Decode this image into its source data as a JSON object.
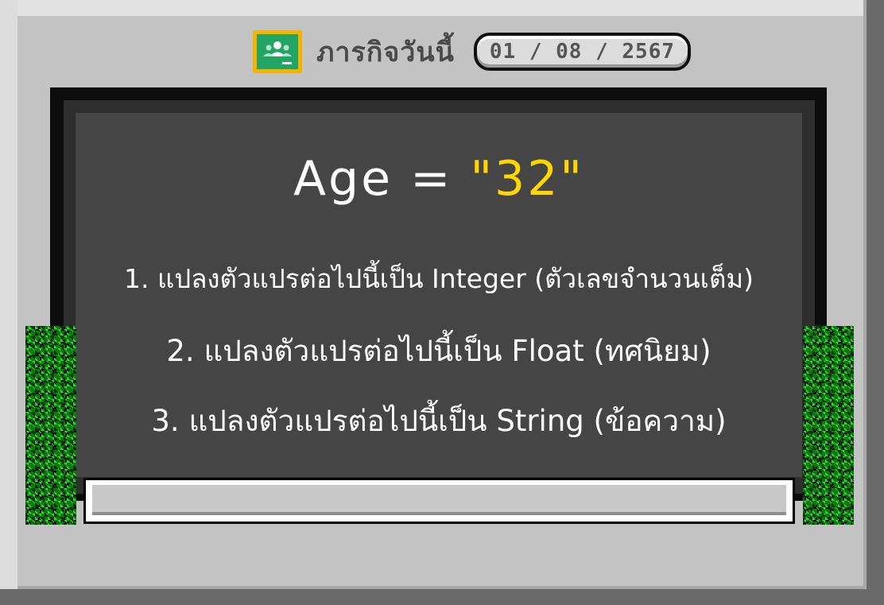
{
  "header": {
    "icon": "google-classroom-icon",
    "title": "ภารกิจวันนี้",
    "date": "01 / 08 / 2567"
  },
  "board": {
    "variable": "Age = ",
    "value": "\"32\"",
    "tasks": [
      "1. แปลงตัวแปรต่อไปนี้เป็น Integer (ตัวเลขจำนวนเต็ม)",
      "2. แปลงตัวแปรต่อไปนี้เป็น Float (ทศนิยม)",
      "3. แปลงตัวแปรต่อไปนี้เป็น String (ข้อความ)"
    ]
  },
  "colors": {
    "background": "#c3c3c3",
    "board": "#454545",
    "accent": "#ffd600",
    "classroom_yellow": "#f4b400",
    "classroom_green": "#21a464"
  }
}
